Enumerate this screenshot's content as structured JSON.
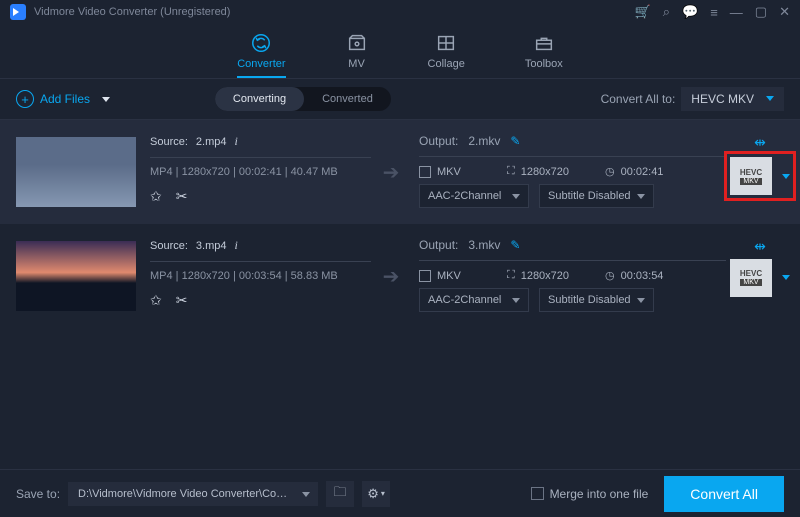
{
  "window": {
    "title": "Vidmore Video Converter (Unregistered)"
  },
  "tabs": {
    "converter": "Converter",
    "mv": "MV",
    "collage": "Collage",
    "toolbox": "Toolbox"
  },
  "toolbar": {
    "add_files": "Add Files",
    "converting": "Converting",
    "converted": "Converted",
    "convert_all_to": "Convert All to:",
    "convert_all_format": "HEVC MKV"
  },
  "items": [
    {
      "source_label": "Source:",
      "source_name": "2.mp4",
      "meta": "MP4 | 1280x720 | 00:02:41 | 40.47 MB",
      "output_label": "Output:",
      "output_name": "2.mkv",
      "container": "MKV",
      "resolution": "1280x720",
      "duration": "00:02:41",
      "audio": "AAC-2Channel",
      "subtitle": "Subtitle Disabled",
      "fmt_top": "HEVC",
      "fmt_bottom": "MKV"
    },
    {
      "source_label": "Source:",
      "source_name": "3.mp4",
      "meta": "MP4 | 1280x720 | 00:03:54 | 58.83 MB",
      "output_label": "Output:",
      "output_name": "3.mkv",
      "container": "MKV",
      "resolution": "1280x720",
      "duration": "00:03:54",
      "audio": "AAC-2Channel",
      "subtitle": "Subtitle Disabled",
      "fmt_top": "HEVC",
      "fmt_bottom": "MKV"
    }
  ],
  "bottom": {
    "save_to": "Save to:",
    "path": "D:\\Vidmore\\Vidmore Video Converter\\Converted",
    "merge": "Merge into one file",
    "convert_all": "Convert All"
  }
}
